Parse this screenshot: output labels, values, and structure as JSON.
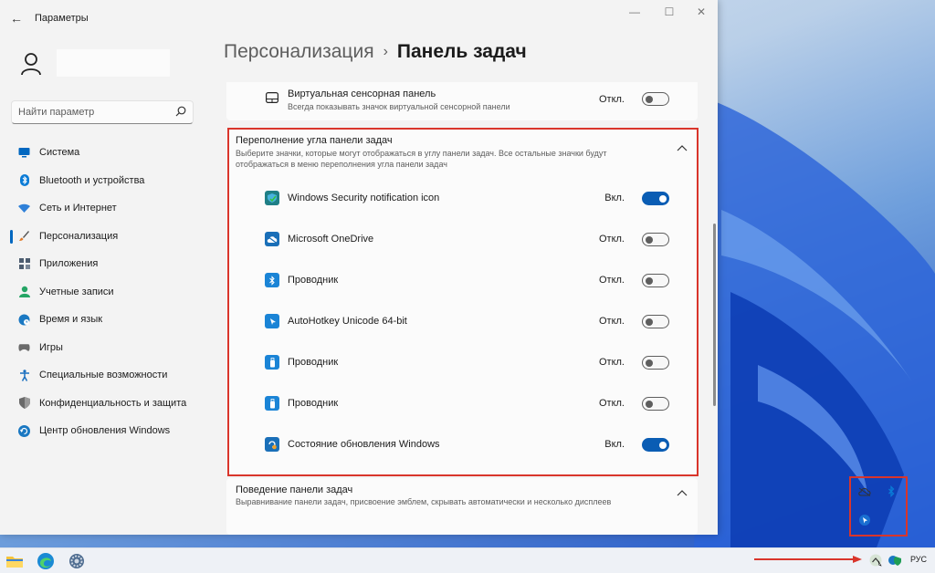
{
  "window": {
    "title": "Параметры"
  },
  "breadcrumb": {
    "parent": "Персонализация",
    "separator": "›",
    "current": "Панель задач"
  },
  "search": {
    "placeholder": "Найти параметр"
  },
  "nav": {
    "items": [
      {
        "label": "Система",
        "icon": "monitor-icon",
        "color": "#0067c0"
      },
      {
        "label": "Bluetooth и устройства",
        "icon": "bluetooth-icon",
        "color": "#0a7bd6"
      },
      {
        "label": "Сеть и Интернет",
        "icon": "wifi-icon",
        "color": "#2f80d8"
      },
      {
        "label": "Персонализация",
        "icon": "brush-icon",
        "color": "#e07b2b"
      },
      {
        "label": "Приложения",
        "icon": "apps-icon",
        "color": "#4d5d70"
      },
      {
        "label": "Учетные записи",
        "icon": "person-icon",
        "color": "#25a565"
      },
      {
        "label": "Время и язык",
        "icon": "globe-icon",
        "color": "#1a78c2"
      },
      {
        "label": "Игры",
        "icon": "gamepad-icon",
        "color": "#6a6a6a"
      },
      {
        "label": "Специальные возможности",
        "icon": "accessibility-icon",
        "color": "#1a6fbf"
      },
      {
        "label": "Конфиденциальность и защита",
        "icon": "shield-icon",
        "color": "#6a6a6a"
      },
      {
        "label": "Центр обновления Windows",
        "icon": "update-icon",
        "color": "#1a78c2"
      }
    ],
    "active": "Персонализация"
  },
  "touchpad": {
    "title": "Виртуальная сенсорная панель",
    "subtitle": "Всегда показывать значок виртуальной сенсорной панели",
    "state": "Откл."
  },
  "overflow": {
    "title": "Переполнение угла панели задач",
    "subtitle1": "Выберите значки, которые могут отображаться в углу панели задач. Все остальные значки будут",
    "subtitle2": "отображаться в меню переполнения угла панели задач",
    "items": [
      {
        "label": "Windows Security notification icon",
        "state": "Вкл.",
        "on": true,
        "icon": "shield-check-icon"
      },
      {
        "label": "Microsoft OneDrive",
        "state": "Откл.",
        "on": false,
        "icon": "cloud-icon"
      },
      {
        "label": "Проводник",
        "state": "Откл.",
        "on": false,
        "icon": "bluetooth-icon"
      },
      {
        "label": "AutoHotkey Unicode 64-bit",
        "state": "Откл.",
        "on": false,
        "icon": "cursor-icon"
      },
      {
        "label": "Проводник",
        "state": "Откл.",
        "on": false,
        "icon": "usb-icon"
      },
      {
        "label": "Проводник",
        "state": "Откл.",
        "on": false,
        "icon": "usb-icon"
      },
      {
        "label": "Состояние обновления Windows",
        "state": "Вкл.",
        "on": true,
        "icon": "update-status-icon"
      }
    ]
  },
  "behavior": {
    "title": "Поведение панели задач",
    "subtitle": "Выравнивание панели задач, присвоение эмблем, скрывать автоматически и несколько дисплеев"
  },
  "taskbar": {
    "language": "РУС"
  },
  "colors": {
    "accent": "#0a5db4",
    "highlight": "#d9352b"
  }
}
